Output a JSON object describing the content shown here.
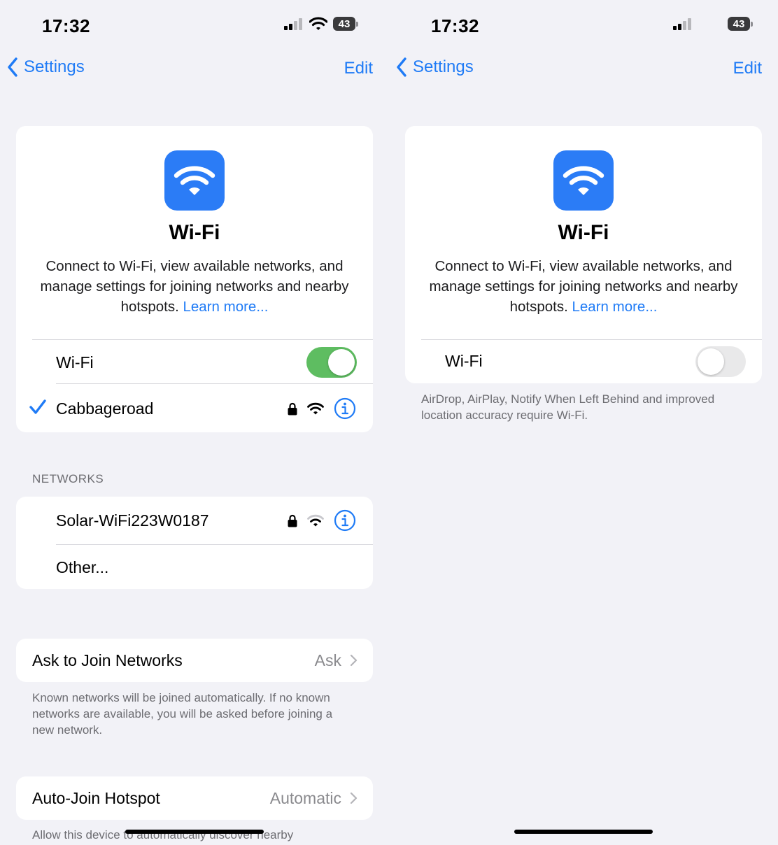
{
  "status_bar": {
    "time": "17:32",
    "battery": "43"
  },
  "nav": {
    "back_label": "Settings",
    "edit_label": "Edit"
  },
  "hero": {
    "title": "Wi-Fi",
    "description": "Connect to Wi-Fi, view available networks, and manage settings for joining networks and nearby hotspots.",
    "learn_more": "Learn more..."
  },
  "left": {
    "wifi_row": {
      "label": "Wi-Fi",
      "toggle_on": true
    },
    "connected_network": {
      "name": "Cabbageroad"
    },
    "networks_header": "NETWORKS",
    "networks": [
      {
        "name": "Solar-WiFi223W0187"
      },
      {
        "name": "Other..."
      }
    ],
    "ask_to_join": {
      "label": "Ask to Join Networks",
      "value": "Ask"
    },
    "ask_to_join_footer": "Known networks will be joined automatically. If no known networks are available, you will be asked before joining a new network.",
    "auto_join": {
      "label": "Auto-Join Hotspot",
      "value": "Automatic"
    },
    "auto_join_footer": "Allow this device to automatically discover nearby"
  },
  "right": {
    "wifi_row": {
      "label": "Wi-Fi",
      "toggle_on": false
    },
    "footer": "AirDrop, AirPlay, Notify When Left Behind and improved location accuracy require Wi-Fi."
  },
  "colors": {
    "accent": "#1f7bf6",
    "toggle_on": "#5ebd61",
    "icon_bg": "#2b7cf6",
    "background": "#f2f2f7"
  },
  "icons": [
    "chevron-left-icon",
    "wifi-icon",
    "lock-icon",
    "info-icon",
    "checkmark-icon",
    "chevron-right-icon",
    "cellular-signal-icon",
    "battery-icon"
  ]
}
